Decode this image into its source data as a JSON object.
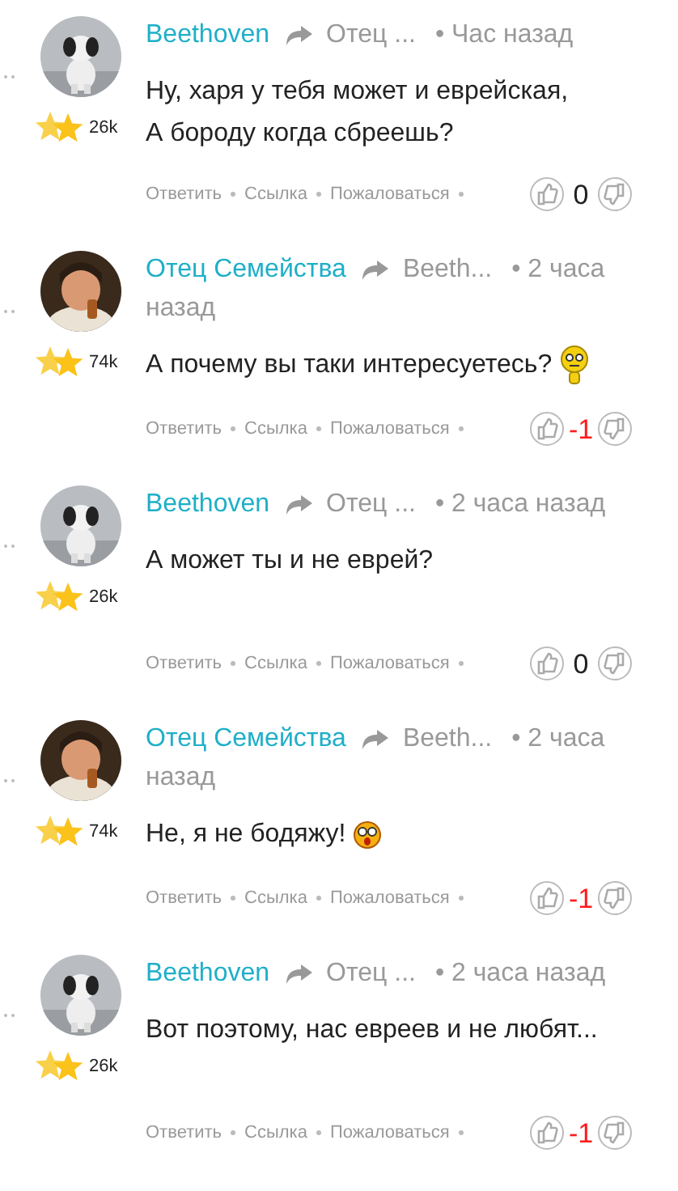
{
  "comments": [
    {
      "author": "Beethoven",
      "reply_to": "Отец ...",
      "time_lines": [
        "• Час назад"
      ],
      "avatar": {
        "kind": "dog"
      },
      "rank": "26k",
      "text": "Ну, харя у тебя может и еврейская,\nА бороду когда сбреешь?",
      "actions": [
        "Ответить",
        "Ссылка",
        "Пожаловаться"
      ],
      "score": {
        "text": "0",
        "kind": "zero"
      }
    },
    {
      "author": "Отец Семейства",
      "reply_to": "Beeth...",
      "time_lines": [
        "• 2 часа",
        "назад"
      ],
      "avatar": {
        "kind": "man"
      },
      "rank": "74k",
      "text": "А почему вы таки интересуетесь?",
      "emoji": {
        "kind": "thinking"
      },
      "actions": [
        "Ответить",
        "Ссылка",
        "Пожаловаться"
      ],
      "score": {
        "text": "-1",
        "kind": "negative"
      }
    },
    {
      "author": "Beethoven",
      "reply_to": "Отец ...",
      "time_lines": [
        "• 2 часа назад"
      ],
      "avatar": {
        "kind": "dog"
      },
      "rank": "26k",
      "text": "А может ты и не еврей?",
      "actions": [
        "Ответить",
        "Ссылка",
        "Пожаловаться"
      ],
      "score": {
        "text": "0",
        "kind": "zero"
      }
    },
    {
      "author": "Отец Семейства",
      "reply_to": "Beeth...",
      "time_lines": [
        "• 2 часа",
        "назад"
      ],
      "avatar": {
        "kind": "man"
      },
      "rank": "74k",
      "text": "Не, я не бодяжу!",
      "emoji": {
        "kind": "surprised"
      },
      "actions": [
        "Ответить",
        "Ссылка",
        "Пожаловаться"
      ],
      "score": {
        "text": "-1",
        "kind": "negative"
      }
    },
    {
      "author": "Beethoven",
      "reply_to": "Отец ...",
      "time_lines": [
        "• 2 часа назад"
      ],
      "avatar": {
        "kind": "dog"
      },
      "rank": "26k",
      "text": "Вот поэтому, нас евреев и не любят...",
      "actions": [
        "Ответить",
        "Ссылка",
        "Пожаловаться"
      ],
      "score": {
        "text": "-1",
        "kind": "negative"
      }
    }
  ]
}
